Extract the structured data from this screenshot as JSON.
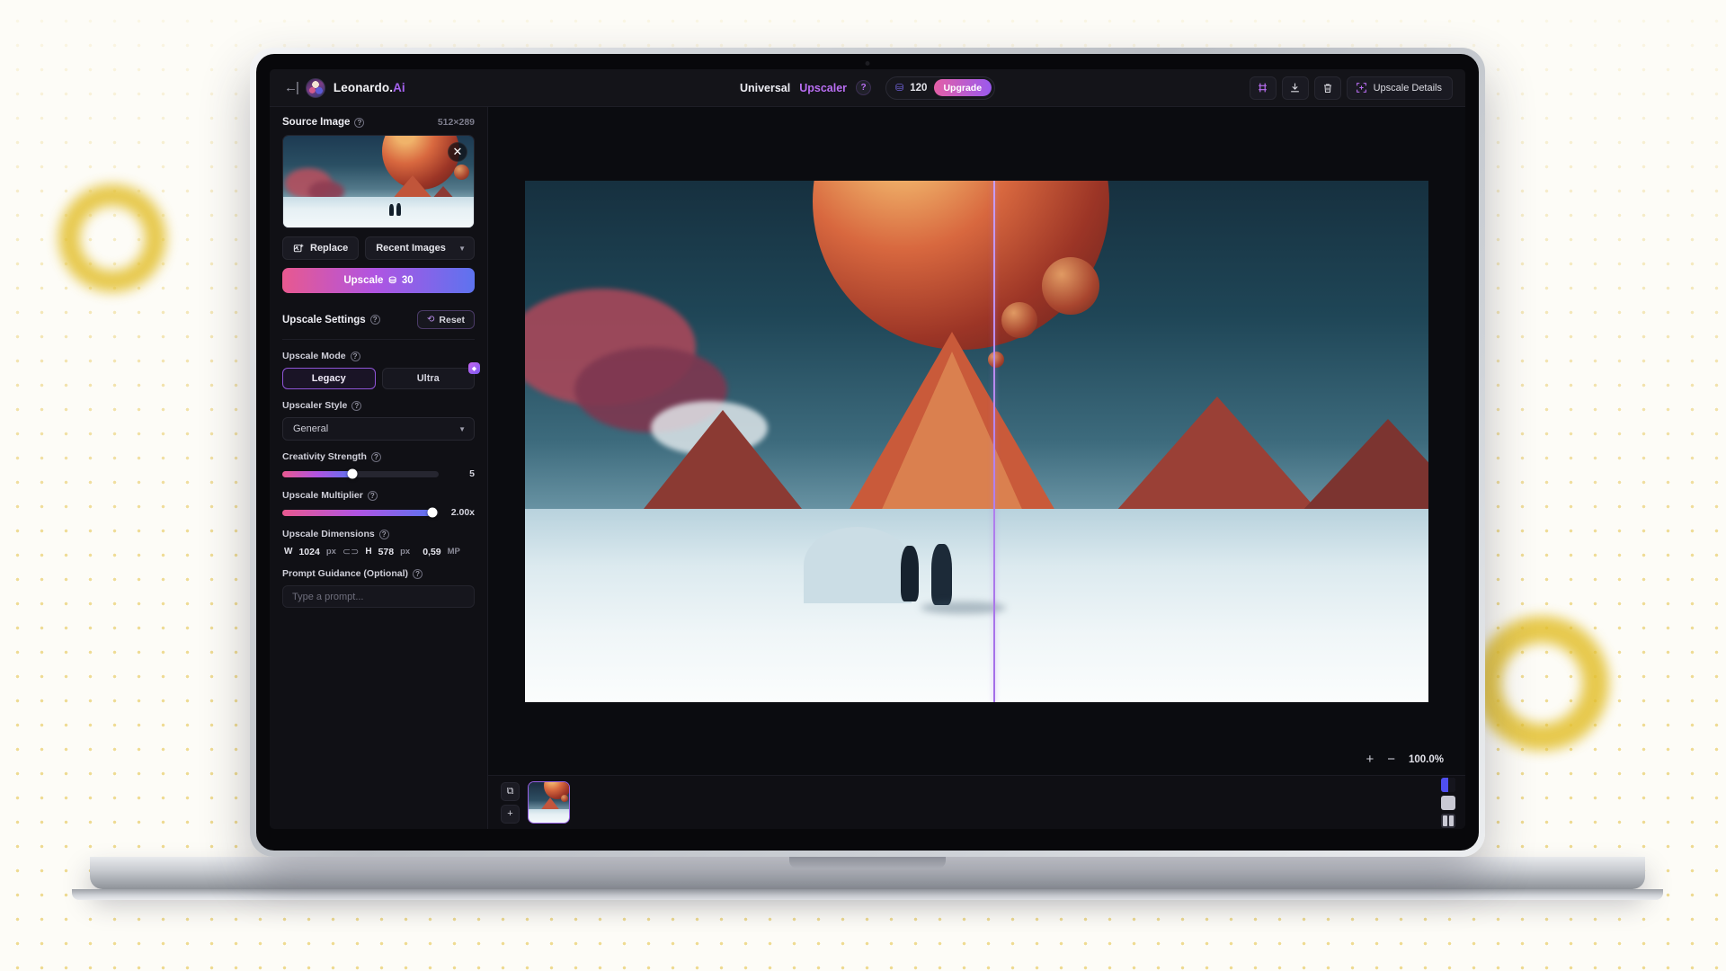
{
  "app": {
    "brand_prefix": "Leonardo",
    "brand_dot": ".",
    "brand_suffix": "Ai",
    "back_arrow": "←|"
  },
  "header": {
    "title_primary": "Universal",
    "title_accent": "Upscaler",
    "help_badge": "?",
    "coin_icon": "coins-icon",
    "credits": "120",
    "upgrade_label": "Upgrade",
    "icons": [
      {
        "name": "flux-icon",
        "glyph": "⫼"
      },
      {
        "name": "download-icon",
        "glyph": "⤓"
      },
      {
        "name": "trash-icon",
        "glyph": "🗑"
      }
    ],
    "upscale_details_label": "Upscale Details"
  },
  "sidebar": {
    "source": {
      "title": "Source Image",
      "info": "?",
      "dimensions": "512×289",
      "close_glyph": "✕"
    },
    "replace_label": "Replace",
    "recent_label": "Recent Images",
    "caret": "▼",
    "cta": {
      "label": "Upscale",
      "coin_glyph": "⛁",
      "cost": "30"
    },
    "settings": {
      "title": "Upscale Settings",
      "info": "?",
      "reset_label": "Reset",
      "reset_glyph": "⟲"
    },
    "upscale_mode": {
      "label": "Upscale Mode",
      "info": "?",
      "options": [
        "Legacy",
        "Ultra"
      ],
      "selected": "Legacy",
      "ultra_badge": "◆"
    },
    "upscaler_style": {
      "label": "Upscaler Style",
      "info": "?",
      "value": "General",
      "caret": "▼"
    },
    "creativity_strength": {
      "label": "Creativity Strength",
      "info": "?",
      "value": "5",
      "percent": 45
    },
    "upscale_multiplier": {
      "label": "Upscale Multiplier",
      "info": "?",
      "value": "2.00x",
      "percent": 96
    },
    "dimensions": {
      "label": "Upscale Dimensions",
      "info": "?",
      "width_key": "W",
      "width_value": "1024",
      "width_unit": "px",
      "link_glyph": "⊂⊃",
      "height_key": "H",
      "height_value": "578",
      "height_unit": "px",
      "megapixels": "0,59",
      "megapixels_unit": "MP"
    },
    "prompt": {
      "label": "Prompt Guidance (Optional)",
      "info": "?",
      "value": "",
      "placeholder": "Type a prompt..."
    }
  },
  "canvas": {
    "zoom_in": "+",
    "zoom_out": "−",
    "zoom_level": "100.0%",
    "divider_position_percent": 51.8
  },
  "filmstrip": {
    "tools": [
      {
        "name": "compare-tool",
        "glyph": "⧉"
      },
      {
        "name": "add-image-tool",
        "glyph": "+"
      }
    ],
    "view_modes": [
      {
        "name": "view-split",
        "glyph": ""
      },
      {
        "name": "view-single",
        "glyph": ""
      },
      {
        "name": "view-grid",
        "glyph": ""
      }
    ]
  },
  "colors": {
    "accent_purple": "#b96ef2",
    "gradient_start": "#e8598f",
    "gradient_mid": "#b054e2",
    "gradient_end": "#5d73ef",
    "background": "#fdfcf7",
    "dot_gold": "#e2be3c",
    "panel": "#101015"
  }
}
